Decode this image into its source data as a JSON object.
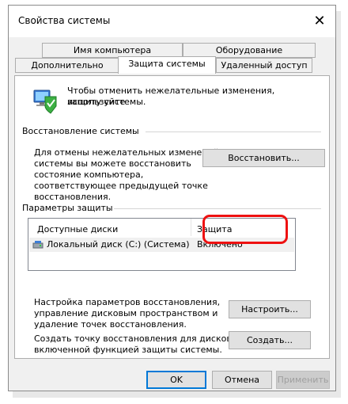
{
  "window": {
    "title": "Свойства системы",
    "close_glyph": "✕"
  },
  "tabs_row1": [
    {
      "label": "Имя компьютера"
    },
    {
      "label": "Оборудование"
    }
  ],
  "tabs_row2": [
    {
      "label": "Дополнительно"
    },
    {
      "label": "Защита системы",
      "active": true
    },
    {
      "label": "Удаленный доступ"
    }
  ],
  "intro": {
    "icon": "system-protection-icon",
    "line1": "Чтобы отменить нежелательные изменения, используйте",
    "line2": "защиту системы."
  },
  "restore": {
    "heading": "Восстановление системы",
    "desc": [
      "Для отмены нежелательных изменений",
      "системы вы можете восстановить",
      "состояние компьютера,",
      "соответствующее предыдущей точке",
      "восстановления."
    ],
    "button": "Восстановить..."
  },
  "protection": {
    "heading": "Параметры защиты",
    "columns": [
      "Доступные диски",
      "Защита"
    ],
    "rows": [
      {
        "drive": "Локальный диск (C:) (Система)",
        "status": "Включено",
        "icon": "drive-icon"
      }
    ],
    "configure_desc": [
      "Настройка параметров восстановления,",
      "управление дисковым пространством и",
      "удаление точек восстановления."
    ],
    "configure_button": "Настроить...",
    "create_desc": [
      "Создать точку восстановления для дисков с",
      "включенной функцией защиты системы."
    ],
    "create_button": "Создать..."
  },
  "footer": {
    "ok": "OK",
    "cancel": "Отмена",
    "apply": "Применить"
  },
  "colors": {
    "highlight": "#ee1111",
    "accent": "#0078d7"
  }
}
